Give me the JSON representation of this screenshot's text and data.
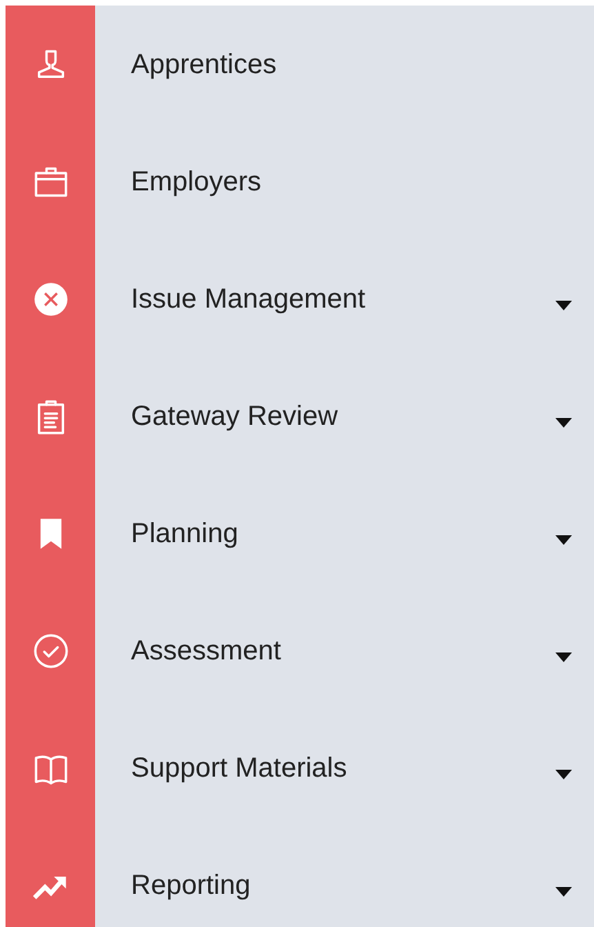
{
  "menu": [
    {
      "label": "Apprentices",
      "has_submenu": false
    },
    {
      "label": "Employers",
      "has_submenu": false
    },
    {
      "label": "Issue Management",
      "has_submenu": true
    },
    {
      "label": "Gateway Review",
      "has_submenu": true
    },
    {
      "label": "Planning",
      "has_submenu": true
    },
    {
      "label": "Assessment",
      "has_submenu": true
    },
    {
      "label": "Support Materials",
      "has_submenu": true
    },
    {
      "label": "Reporting",
      "has_submenu": true
    }
  ]
}
